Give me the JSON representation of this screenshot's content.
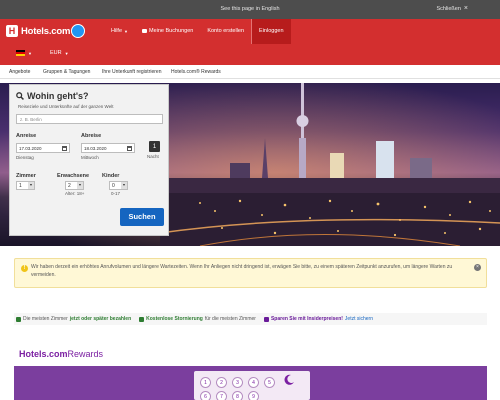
{
  "translate_bar": {
    "translate_link": "See this page in English",
    "close_label": "Schließen",
    "close_icon": "close-icon"
  },
  "header": {
    "brand": "Hotels.com",
    "nav": [
      {
        "label": "Hilfe",
        "icon": "chevron-down-icon"
      },
      {
        "label": "Meine Buchungen",
        "icon": "booking-icon"
      },
      {
        "label": "Konto erstellen"
      },
      {
        "label": "Einloggen"
      }
    ],
    "currency": "EUR",
    "language_flag": "de-flag",
    "colors": {
      "brand_red": "#d32f2f",
      "login_bg": "#b71c1c"
    }
  },
  "subnav": [
    "Angebote",
    "Gruppen & Tagungen",
    "Ihre Unterkunft registrieren",
    "Hotels.com® Rewards"
  ],
  "search": {
    "title": "Wohin geht's?",
    "subtitle": "Reiseziele und Unterkünfte auf der ganzen Welt",
    "destination_placeholder": "z. B. Berlin",
    "checkin_label": "Anreise",
    "checkin_value": "17.03.2020",
    "checkin_day": "Dienstag",
    "checkout_label": "Abreise",
    "checkout_value": "18.03.2020",
    "checkout_day": "Mittwoch",
    "nights_count": "1",
    "nights_label": "Nacht",
    "rooms_label": "Zimmer",
    "rooms_value": "1",
    "adults_label": "Erwachsene",
    "adults_value": "2",
    "adults_hint": "Alter: 18+",
    "children_label": "Kinder",
    "children_value": "0",
    "children_hint": "0-17",
    "submit_label": "Suchen",
    "colors": {
      "button": "#1565c0"
    }
  },
  "notice": {
    "icon": "warning-icon",
    "text": "Wir haben derzeit ein erhöhtes Anrufvolumen und längere Wartezeiten. Wenn Ihr Anliegen nicht dringend ist, erwägen Sie bitte, zu einem späteren Zeitpunkt anzurufen, um längere Warten zu vermeiden."
  },
  "benefits": [
    {
      "pre": "Die meisten Zimmer",
      "highlight": "jetzt oder später bezahlen",
      "post": "",
      "icon": "check-icon"
    },
    {
      "pre": "",
      "highlight": "Kostenlose Stornierung",
      "post": "für die meisten Zimmer",
      "icon": "calendar-check-icon"
    },
    {
      "pre": "",
      "highlight": "Sparen Sie mit Insiderpreisen!",
      "post": "Jetzt sichern",
      "icon": "lock-icon"
    }
  ],
  "rewards": {
    "logo_part1": "Hotels.com",
    "logo_part2": "Rewards",
    "stamps": [
      "1",
      "2",
      "3",
      "4",
      "5",
      "6",
      "7",
      "8",
      "9"
    ],
    "icon": "moon-icon",
    "colors": {
      "band": "#7b3e9e"
    }
  }
}
